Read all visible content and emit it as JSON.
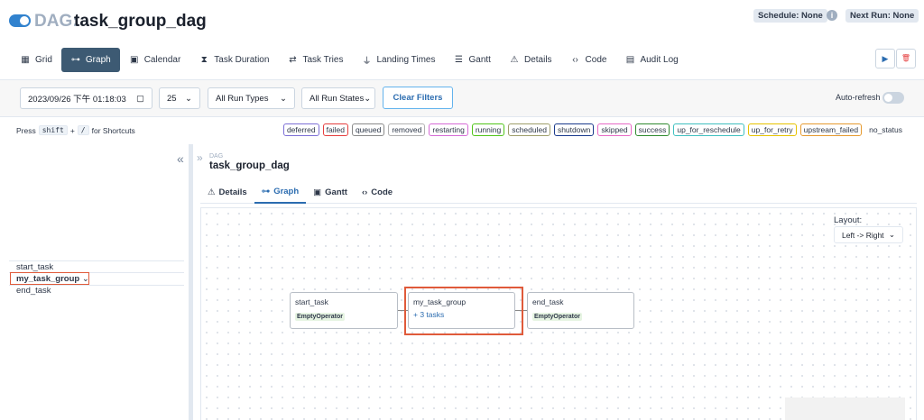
{
  "header": {
    "dag_prefix": "DAG:",
    "dag_id": "task_group_dag",
    "schedule": "Schedule: None",
    "info_icon": "i",
    "next_run": "Next Run: None"
  },
  "nav": {
    "grid": "Grid",
    "graph": "Graph",
    "calendar": "Calendar",
    "task_duration": "Task Duration",
    "task_tries": "Task Tries",
    "landing_times": "Landing Times",
    "gantt": "Gantt",
    "details": "Details",
    "code": "Code",
    "audit_log": "Audit Log"
  },
  "actions": {
    "trigger_icon": "▶",
    "delete_icon": "🗑"
  },
  "filters": {
    "datetime": "2023/09/26 下午 01:18:03",
    "num_runs": "25",
    "run_types": "All Run Types",
    "run_states": "All Run States",
    "clear": "Clear Filters",
    "auto_refresh": "Auto-refresh"
  },
  "shortcuts": {
    "press": "Press",
    "key1": "shift",
    "plus": "+",
    "key2": "/",
    "suffix": "for Shortcuts"
  },
  "legend": [
    {
      "label": "deferred",
      "color": "#7c6fd6"
    },
    {
      "label": "failed",
      "color": "#e53e3e"
    },
    {
      "label": "queued",
      "color": "#8a8a8a"
    },
    {
      "label": "removed",
      "color": "#b0b0b0"
    },
    {
      "label": "restarting",
      "color": "#d66ad6"
    },
    {
      "label": "running",
      "color": "#52c41a"
    },
    {
      "label": "scheduled",
      "color": "#9e9e6a"
    },
    {
      "label": "shutdown",
      "color": "#1a3a8c"
    },
    {
      "label": "skipped",
      "color": "#e86ac6"
    },
    {
      "label": "success",
      "color": "#2f8a2f"
    },
    {
      "label": "up_for_reschedule",
      "color": "#40c0c0"
    },
    {
      "label": "up_for_retry",
      "color": "#e6c200"
    },
    {
      "label": "upstream_failed",
      "color": "#e69a2f"
    },
    {
      "label": "no_status",
      "color": "transparent"
    }
  ],
  "tree": {
    "start_task": "start_task",
    "my_task_group": "my_task_group",
    "chevron": "⌄",
    "end_task": "end_task"
  },
  "pane": {
    "dag_small": "DAG",
    "dag_name": "task_group_dag",
    "tabs": {
      "details": "Details",
      "graph": "Graph",
      "gantt": "Gantt",
      "code": "Code"
    }
  },
  "graph": {
    "layout_label": "Layout:",
    "layout_value": "Left -> Right",
    "nodes": {
      "start_task": {
        "title": "start_task",
        "operator": "EmptyOperator"
      },
      "my_task_group": {
        "title": "my_task_group",
        "subtitle": "+ 3 tasks"
      },
      "end_task": {
        "title": "end_task",
        "operator": "EmptyOperator"
      }
    }
  }
}
